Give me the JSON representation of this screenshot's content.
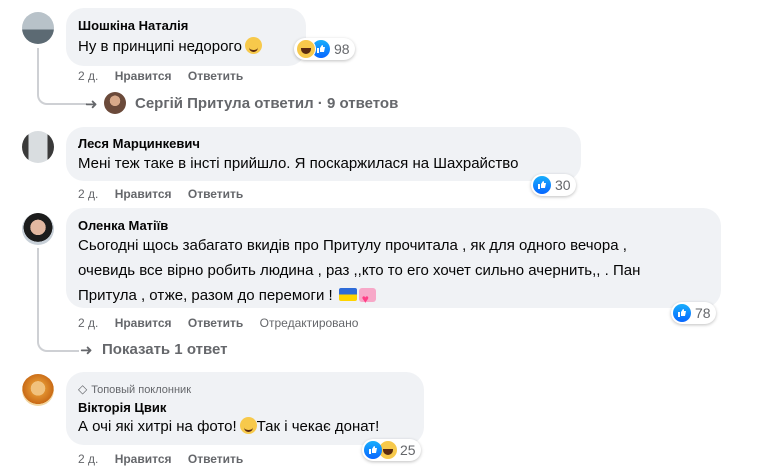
{
  "comments": [
    {
      "author": "Шошкіна Наталія",
      "text_lines": [
        "Ну в принципі недорого"
      ],
      "time": "2 д.",
      "like_label": "Нравится",
      "reply_label": "Ответить",
      "reactions": {
        "icons": [
          "like-icon",
          "haha-icon"
        ],
        "count": "98"
      }
    },
    {
      "author": "Леся Марцинкевич",
      "text_lines": [
        "Мені теж таке в інсті прийшло. Я поскаржилася на Шахрайство"
      ],
      "time": "2 д.",
      "like_label": "Нравится",
      "reply_label": "Ответить",
      "reactions": {
        "icons": [
          "like-icon"
        ],
        "count": "30"
      }
    },
    {
      "author": "Оленка Матіїв",
      "text_lines": [
        "Сьогодні щось забагато вкидів про Притулу прочитала , як для одного вечора ,",
        "очевидь все вірно робить людина , раз ,,кто то его хочет сильно ачернить,, . Пан",
        "Притула , отже, разом до перемоги !"
      ],
      "time": "2 д.",
      "like_label": "Нравится",
      "reply_label": "Ответить",
      "edited_label": "Отредактировано",
      "reactions": {
        "icons": [
          "like-icon"
        ],
        "count": "78"
      }
    },
    {
      "badge": "Топовый поклонник",
      "author": "Вікторія Цвик",
      "text_lines": [
        "А очі які хитрі на фото!",
        "Так і чекає донат!"
      ],
      "time": "2 д.",
      "like_label": "Нравится",
      "reply_label": "Ответить",
      "reactions": {
        "icons": [
          "like-icon",
          "haha-icon"
        ],
        "count": "25"
      }
    }
  ],
  "reply_threads": [
    {
      "author": "Сергій Притула",
      "action": "ответил",
      "separator": "·",
      "count_label": "9 ответов"
    },
    {
      "label": "Показать 1 ответ"
    }
  ],
  "colors": {
    "bubble": "#f0f2f5",
    "secondary_text": "#65676b",
    "like_blue": "#0866ff"
  }
}
